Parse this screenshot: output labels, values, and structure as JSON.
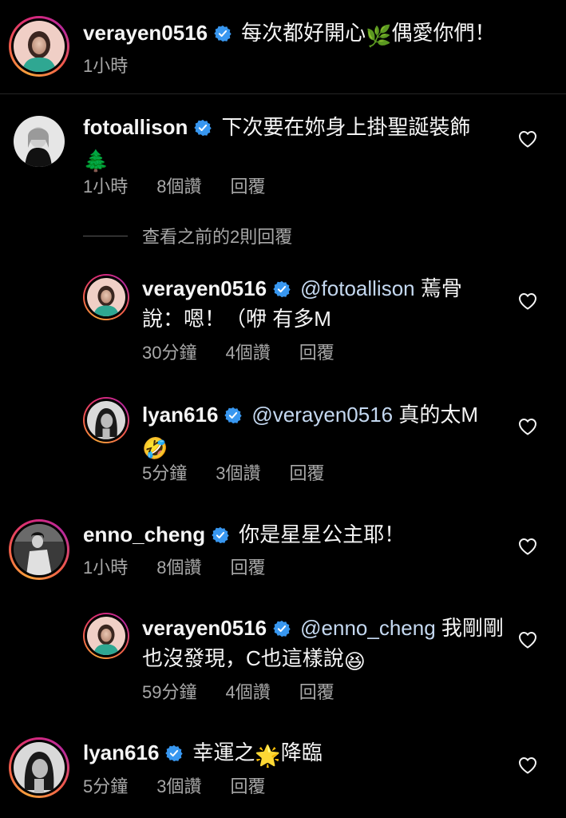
{
  "comments": [
    {
      "username": "verayen0516",
      "text": "每次都好開心",
      "emoji1": "🌿",
      "text2": "偶愛你們！",
      "time": "1小時"
    },
    {
      "username": "fotoallison",
      "text": "下次要在妳身上掛聖誕裝飾",
      "emoji": "🌲",
      "time": "1小時",
      "likes": "8個讚",
      "reply": "回覆"
    },
    {
      "view_replies": "查看之前的2則回覆"
    },
    {
      "username": "verayen0516",
      "mention": "@fotoallison",
      "text": "蔫骨",
      "text2": "說：嗯！（咿 有多M",
      "time": "30分鐘",
      "likes": "4個讚",
      "reply": "回覆"
    },
    {
      "username": "lyan616",
      "mention": "@verayen0516",
      "text": "真的太M",
      "emoji": "🤣",
      "time": "5分鐘",
      "likes": "3個讚",
      "reply": "回覆"
    },
    {
      "username": "enno_cheng",
      "text": "你是星星公主耶！",
      "time": "1小時",
      "likes": "8個讚",
      "reply": "回覆"
    },
    {
      "username": "verayen0516",
      "mention": "@enno_cheng",
      "text": "我剛剛",
      "text2": "也沒發現，C也這樣說",
      "emoji": "😆",
      "time": "59分鐘",
      "likes": "4個讚",
      "reply": "回覆"
    },
    {
      "username": "lyan616",
      "text": "幸運之",
      "emoji": "🌟",
      "text2": "降臨",
      "time": "5分鐘",
      "likes": "3個讚",
      "reply": "回覆"
    }
  ],
  "colors": {
    "background": "#000000",
    "text": "#f5f5f5",
    "secondary": "#a8a8a8",
    "mention": "#c4d8f0",
    "verified": "#3897f0"
  },
  "icons": {
    "verified": "verified-badge-icon",
    "heart": "heart-outline-icon"
  }
}
